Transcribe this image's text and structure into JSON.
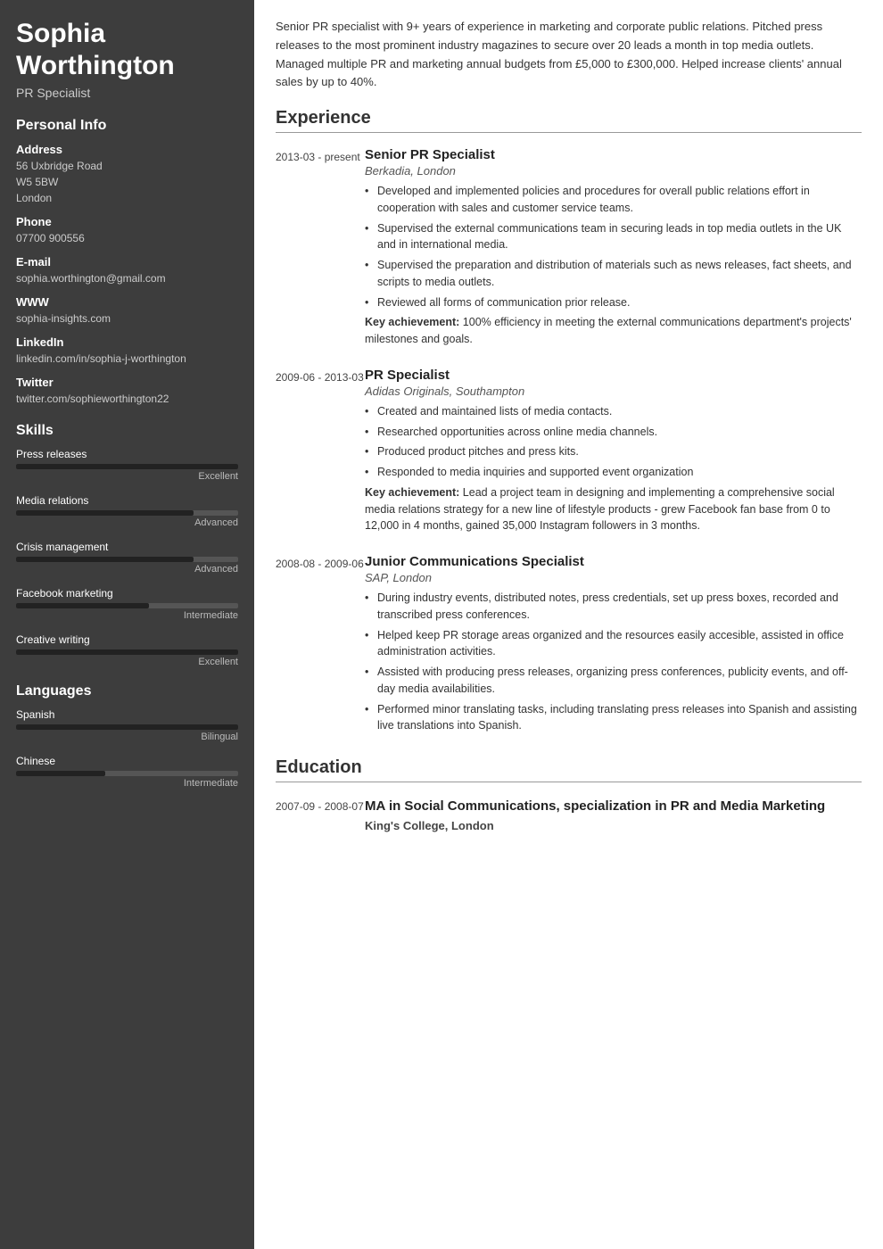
{
  "sidebar": {
    "name": "Sophia Worthington",
    "title": "PR Specialist",
    "personal_info_label": "Personal Info",
    "address_label": "Address",
    "address_lines": [
      "56 Uxbridge Road",
      "W5 5BW",
      "London"
    ],
    "phone_label": "Phone",
    "phone_value": "07700 900556",
    "email_label": "E-mail",
    "email_value": "sophia.worthington@gmail.com",
    "www_label": "WWW",
    "www_value": "sophia-insights.com",
    "linkedin_label": "LinkedIn",
    "linkedin_value": "linkedin.com/in/sophia-j-worthington",
    "twitter_label": "Twitter",
    "twitter_value": "twitter.com/sophieworthington22",
    "skills_label": "Skills",
    "skills": [
      {
        "name": "Press releases",
        "level": "Excellent",
        "pct": 100
      },
      {
        "name": "Media relations",
        "level": "Advanced",
        "pct": 80
      },
      {
        "name": "Crisis management",
        "level": "Advanced",
        "pct": 80
      },
      {
        "name": "Facebook marketing",
        "level": "Intermediate",
        "pct": 60
      },
      {
        "name": "Creative writing",
        "level": "Excellent",
        "pct": 100
      }
    ],
    "languages_label": "Languages",
    "languages": [
      {
        "name": "Spanish",
        "level": "Bilingual",
        "pct": 100
      },
      {
        "name": "Chinese",
        "level": "Intermediate",
        "pct": 40
      }
    ]
  },
  "main": {
    "summary": "Senior PR specialist with 9+ years of experience in marketing and corporate public relations. Pitched press releases to the most prominent industry magazines to secure over 20 leads a month in top media outlets. Managed multiple PR and marketing annual budgets from £5,000 to £300,000. Helped increase clients' annual sales by up to 40%.",
    "experience_title": "Experience",
    "experience": [
      {
        "date": "2013-03 - present",
        "title": "Senior PR Specialist",
        "company": "Berkadia, London",
        "bullets": [
          "Developed and implemented policies and procedures for overall public relations effort in cooperation with sales and customer service teams.",
          "Supervised the external communications team in securing leads in top media outlets in the UK and in international media.",
          "Supervised the preparation and distribution of materials such as news releases, fact sheets, and scripts to media outlets.",
          "Reviewed all forms of communication prior release."
        ],
        "achievement": "Key achievement: 100% efficiency in meeting the external communications department's projects' milestones and goals."
      },
      {
        "date": "2009-06 - 2013-03",
        "title": "PR Specialist",
        "company": "Adidas Originals, Southampton",
        "bullets": [
          "Created and maintained lists of media contacts.",
          "Researched opportunities across online media channels.",
          "Produced product pitches and press kits.",
          "Responded to media inquiries and supported event organization"
        ],
        "achievement": "Key achievement: Lead a project team in designing and implementing a comprehensive social media relations strategy for a new line of lifestyle products - grew Facebook fan base from 0 to 12,000 in 4 months, gained 35,000 Instagram followers in 3 months."
      },
      {
        "date": "2008-08 - 2009-06",
        "title": "Junior Communications Specialist",
        "company": "SAP, London",
        "bullets": [
          "During industry events, distributed notes, press credentials, set up press boxes, recorded and transcribed press conferences.",
          "Helped keep PR storage areas organized and the resources easily accesible, assisted in office administration activities.",
          "Assisted with producing press releases, organizing press conferences, publicity events, and off-day media availabilities.",
          "Performed minor translating tasks, including translating press releases into Spanish and assisting live translations into Spanish."
        ],
        "achievement": ""
      }
    ],
    "education_title": "Education",
    "education": [
      {
        "date": "2007-09 - 2008-07",
        "degree": "MA in Social Communications, specialization in PR and Media Marketing",
        "school": "King's College, London"
      }
    ]
  }
}
